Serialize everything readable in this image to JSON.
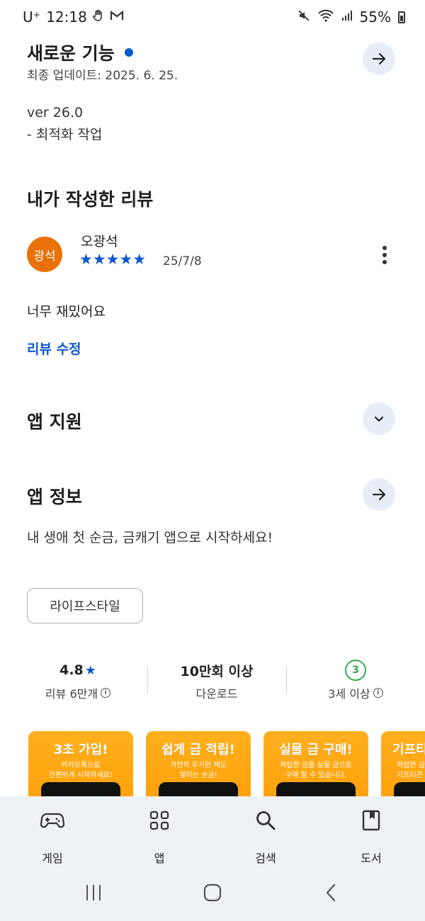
{
  "status_bar": {
    "carrier": "U⁺",
    "time": "12:18",
    "battery": "55%",
    "icons": [
      "hand-icon",
      "gmail-icon",
      "mute-icon",
      "wifi-icon",
      "signal-icon",
      "battery-icon"
    ]
  },
  "whats_new": {
    "title": "새로운 기능",
    "updated": "최종 업데이트: 2025. 6. 25.",
    "version": "ver 26.0",
    "note": "- 최적화 작업"
  },
  "my_review": {
    "title": "내가 작성한 리뷰",
    "avatar_text": "광석",
    "avatar_color": "#e8710a",
    "reviewer": "오광석",
    "stars": "★★★★★",
    "rating": 5,
    "date": "25/7/8",
    "text": "너무 재밌어요",
    "edit_label": "리뷰 수정"
  },
  "app_support": {
    "title": "앱 지원"
  },
  "app_info": {
    "title": "앱 정보",
    "description": "내 생애 첫 순금, 금캐기 앱으로 시작하세요!",
    "category_chip": "라이프스타일"
  },
  "stats": {
    "rating": {
      "value": "4.8",
      "label": "리뷰 6만개"
    },
    "downloads": {
      "value": "10만회 이상",
      "label": "다운로드"
    },
    "age": {
      "value": "3",
      "label": "3세 이상"
    }
  },
  "screenshots": [
    {
      "heading": "3초 가입!",
      "sub": "카카오톡으로\n간편하게 시작하세요!"
    },
    {
      "heading": "쉽게 금 적립!",
      "sub": "가만히 두기만 해도\n쌓이는 순금!"
    },
    {
      "heading": "실물 금 구매!",
      "sub": "적립한 금을 실물 금으로\n구매 할 수 있습니다."
    },
    {
      "heading": "기프티",
      "sub": "적립한 금\n기프티콘"
    }
  ],
  "bottom_nav": [
    {
      "label": "게임",
      "icon": "gamepad-icon"
    },
    {
      "label": "앱",
      "icon": "apps-grid-icon"
    },
    {
      "label": "검색",
      "icon": "search-icon"
    },
    {
      "label": "도서",
      "icon": "book-icon"
    }
  ],
  "colors": {
    "accent": "#0b57d0",
    "avatar": "#e8710a",
    "age_badge": "#34a853",
    "nav_bg": "#eef1f6",
    "button_bg": "#e8eef7"
  }
}
